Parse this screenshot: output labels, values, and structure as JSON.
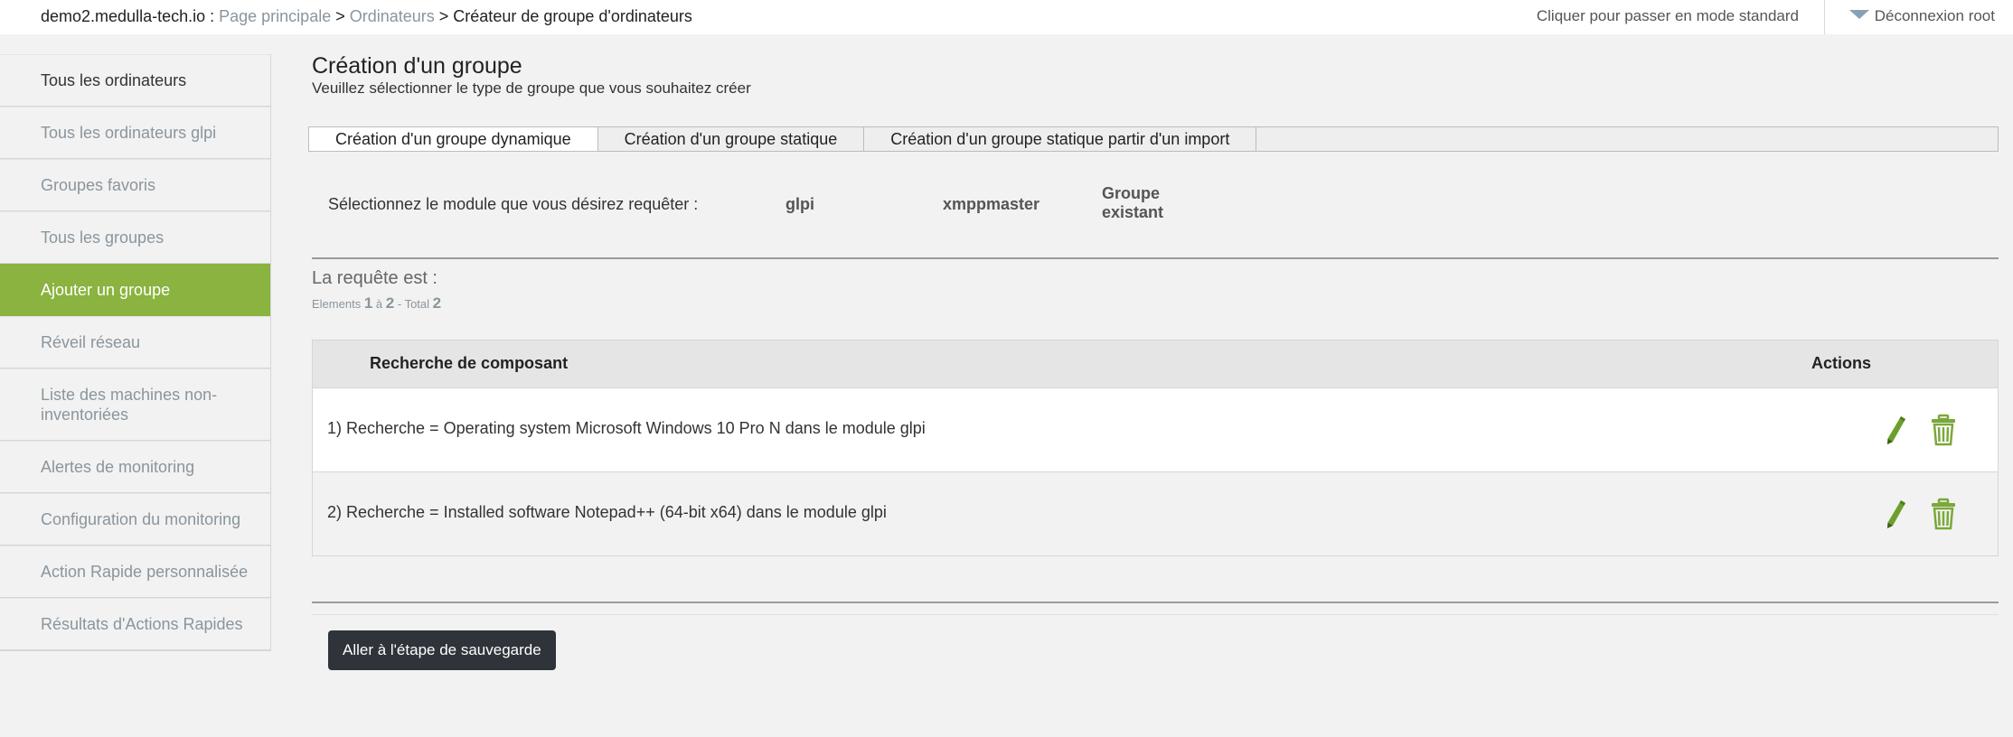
{
  "breadcrumb": {
    "host": "demo2.medulla-tech.io",
    "host_sep": " : ",
    "home": "Page principale",
    "sep1": " > ",
    "computers": "Ordinateurs",
    "sep2": " > ",
    "current": "Créateur de groupe d'ordinateurs"
  },
  "header": {
    "mode_switch": "Cliquer pour passer en mode standard",
    "logout": "Déconnexion root"
  },
  "sidebar": {
    "items": [
      {
        "label": "Tous les ordinateurs"
      },
      {
        "label": "Tous les ordinateurs glpi"
      },
      {
        "label": "Groupes favoris"
      },
      {
        "label": "Tous les groupes"
      },
      {
        "label": "Ajouter un groupe"
      },
      {
        "label": "Réveil réseau"
      },
      {
        "label": "Liste des machines non-inventoriées"
      },
      {
        "label": "Alertes de monitoring"
      },
      {
        "label": "Configuration du monitoring"
      },
      {
        "label": "Action Rapide personnalisée"
      },
      {
        "label": "Résultats d'Actions Rapides"
      }
    ],
    "active_index": 4
  },
  "main": {
    "title": "Création d'un groupe",
    "subtitle": "Veuillez sélectionner le type de groupe que vous souhaitez créer",
    "tabs": [
      {
        "label": "Création d'un groupe dynamique"
      },
      {
        "label": "Création d'un groupe statique"
      },
      {
        "label": "Création d'un groupe statique partir d'un import"
      }
    ],
    "module_prompt": "Sélectionnez le module que vous désirez requêter :",
    "modules": [
      {
        "label": "glpi"
      },
      {
        "label": "xmppmaster"
      },
      {
        "label_line1": "Groupe",
        "label_line2": "existant"
      }
    ],
    "request_label": "La requête est :",
    "pager": {
      "elements_label": "Elements",
      "from": "1",
      "to_label": "à",
      "to": "2",
      "total_label": "- Total",
      "total": "2"
    },
    "table": {
      "col_component": "Recherche de composant",
      "col_actions": "Actions",
      "rows": [
        {
          "text": "1) Recherche = Operating system Microsoft Windows 10 Pro N dans le module glpi"
        },
        {
          "text": "2) Recherche = Installed software Notepad++ (64-bit x64) dans le module glpi"
        }
      ]
    },
    "save_button": "Aller à l'étape de sauvegarde"
  },
  "colors": {
    "accent_green": "#8ab33f",
    "button_dark": "#2f343a",
    "link_gray": "#8a959d"
  }
}
